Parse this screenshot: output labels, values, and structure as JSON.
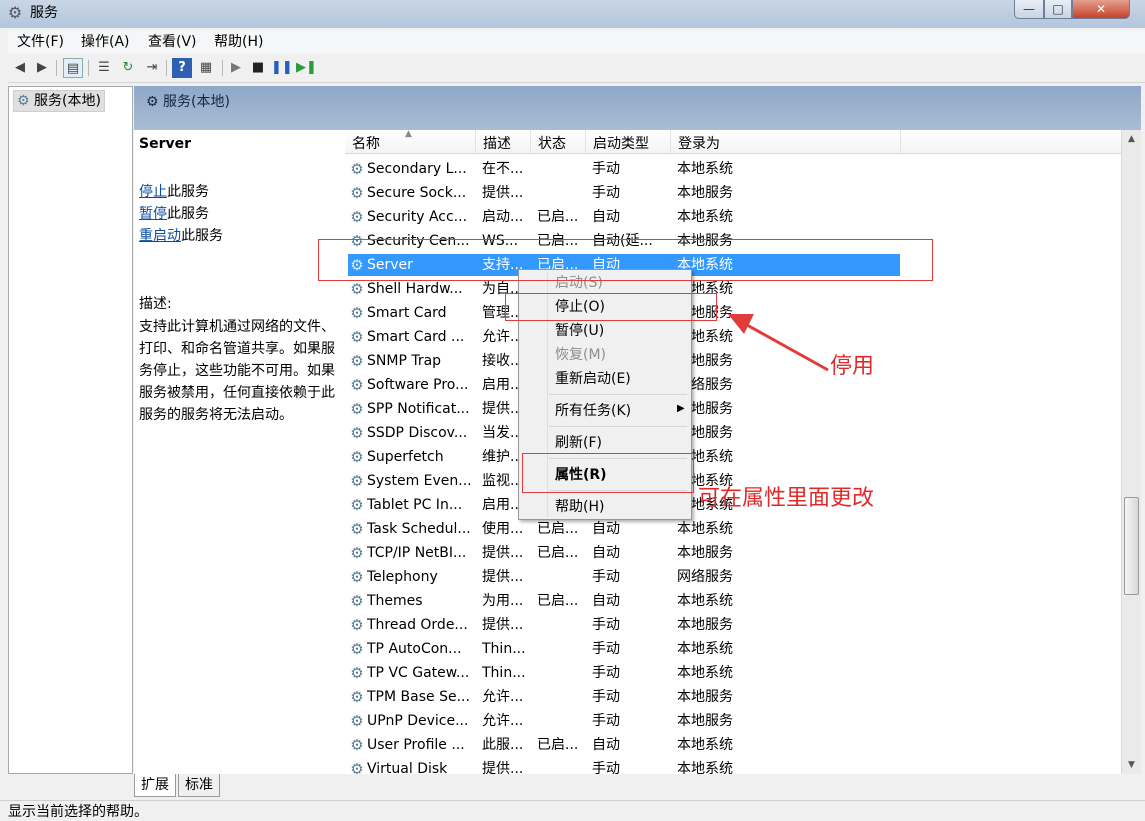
{
  "window": {
    "title": "服务",
    "min": "—",
    "max": "□",
    "close": "✕"
  },
  "menubar": [
    "文件(F)",
    "操作(A)",
    "查看(V)",
    "帮助(H)"
  ],
  "tree": {
    "item": "服务(本地)"
  },
  "header": {
    "title": "服务(本地)"
  },
  "detail": {
    "service_name": "Server",
    "actions": [
      {
        "link": "停止",
        "suffix": "此服务"
      },
      {
        "link": "暂停",
        "suffix": "此服务"
      },
      {
        "link": "重启动",
        "suffix": "此服务"
      }
    ],
    "desc_label": "描述:",
    "desc_text": "支持此计算机通过网络的文件、打印、和命名管道共享。如果服务停止，这些功能不可用。如果服务被禁用，任何直接依赖于此服务的服务将无法启动。"
  },
  "columns": [
    "名称",
    "描述",
    "状态",
    "启动类型",
    "登录为"
  ],
  "rows": [
    {
      "name": "Secondary L...",
      "desc": "在不...",
      "status": "",
      "startup": "手动",
      "logon": "本地系统"
    },
    {
      "name": "Secure Sock...",
      "desc": "提供...",
      "status": "",
      "startup": "手动",
      "logon": "本地服务"
    },
    {
      "name": "Security Acc...",
      "desc": "启动...",
      "status": "已启...",
      "startup": "自动",
      "logon": "本地系统"
    },
    {
      "name": "Security Cen...",
      "desc": "WS...",
      "status": "已启...",
      "startup": "自动(延...",
      "logon": "本地服务"
    },
    {
      "name": "Server",
      "desc": "支持...",
      "status": "已启...",
      "startup": "自动",
      "logon": "本地系统"
    },
    {
      "name": "Shell Hardw...",
      "desc": "为自...",
      "status": "",
      "startup": "",
      "logon": "本地系统"
    },
    {
      "name": "Smart Card",
      "desc": "管理...",
      "status": "",
      "startup": "",
      "logon": "本地服务"
    },
    {
      "name": "Smart Card ...",
      "desc": "允许...",
      "status": "",
      "startup": "",
      "logon": "本地系统"
    },
    {
      "name": "SNMP Trap",
      "desc": "接收...",
      "status": "",
      "startup": "",
      "logon": "本地服务"
    },
    {
      "name": "Software Pro...",
      "desc": "启用...",
      "status": "",
      "startup": "",
      "logon": "网络服务"
    },
    {
      "name": "SPP Notificat...",
      "desc": "提供...",
      "status": "",
      "startup": "",
      "logon": "本地服务"
    },
    {
      "name": "SSDP Discov...",
      "desc": "当发...",
      "status": "",
      "startup": "",
      "logon": "本地服务"
    },
    {
      "name": "Superfetch",
      "desc": "维护...",
      "status": "",
      "startup": "",
      "logon": "本地系统"
    },
    {
      "name": "System Even...",
      "desc": "监视...",
      "status": "",
      "startup": "",
      "logon": "本地系统"
    },
    {
      "name": "Tablet PC In...",
      "desc": "启用...",
      "status": "",
      "startup": "",
      "logon": "本地系统"
    },
    {
      "name": "Task Schedul...",
      "desc": "使用...",
      "status": "已启...",
      "startup": "自动",
      "logon": "本地系统"
    },
    {
      "name": "TCP/IP NetBI...",
      "desc": "提供...",
      "status": "已启...",
      "startup": "自动",
      "logon": "本地服务"
    },
    {
      "name": "Telephony",
      "desc": "提供...",
      "status": "",
      "startup": "手动",
      "logon": "网络服务"
    },
    {
      "name": "Themes",
      "desc": "为用...",
      "status": "已启...",
      "startup": "自动",
      "logon": "本地系统"
    },
    {
      "name": "Thread Orde...",
      "desc": "提供...",
      "status": "",
      "startup": "手动",
      "logon": "本地服务"
    },
    {
      "name": "TP AutoCon...",
      "desc": "Thin...",
      "status": "",
      "startup": "手动",
      "logon": "本地系统"
    },
    {
      "name": "TP VC Gatew...",
      "desc": "Thin...",
      "status": "",
      "startup": "手动",
      "logon": "本地系统"
    },
    {
      "name": "TPM Base Se...",
      "desc": "允许...",
      "status": "",
      "startup": "手动",
      "logon": "本地服务"
    },
    {
      "name": "UPnP Device...",
      "desc": "允许...",
      "status": "",
      "startup": "手动",
      "logon": "本地服务"
    },
    {
      "name": "User Profile ...",
      "desc": "此服...",
      "status": "已启...",
      "startup": "自动",
      "logon": "本地系统"
    },
    {
      "name": "Virtual Disk",
      "desc": "提供...",
      "status": "",
      "startup": "手动",
      "logon": "本地系统"
    }
  ],
  "context_menu": {
    "start": "启动(S)",
    "stop": "停止(O)",
    "pause": "暂停(U)",
    "resume": "恢复(M)",
    "restart": "重新启动(E)",
    "all_tasks": "所有任务(K)",
    "refresh": "刷新(F)",
    "properties": "属性(R)",
    "help": "帮助(H)"
  },
  "annotations": {
    "disable": "停用",
    "properties_note": "可在属性里面更改"
  },
  "tabs": [
    "扩展",
    "标准"
  ],
  "status": "显示当前选择的帮助。",
  "colors": {
    "selection": "#3399ff",
    "annotation": "#e23b3b",
    "link": "#0a4aa7"
  }
}
